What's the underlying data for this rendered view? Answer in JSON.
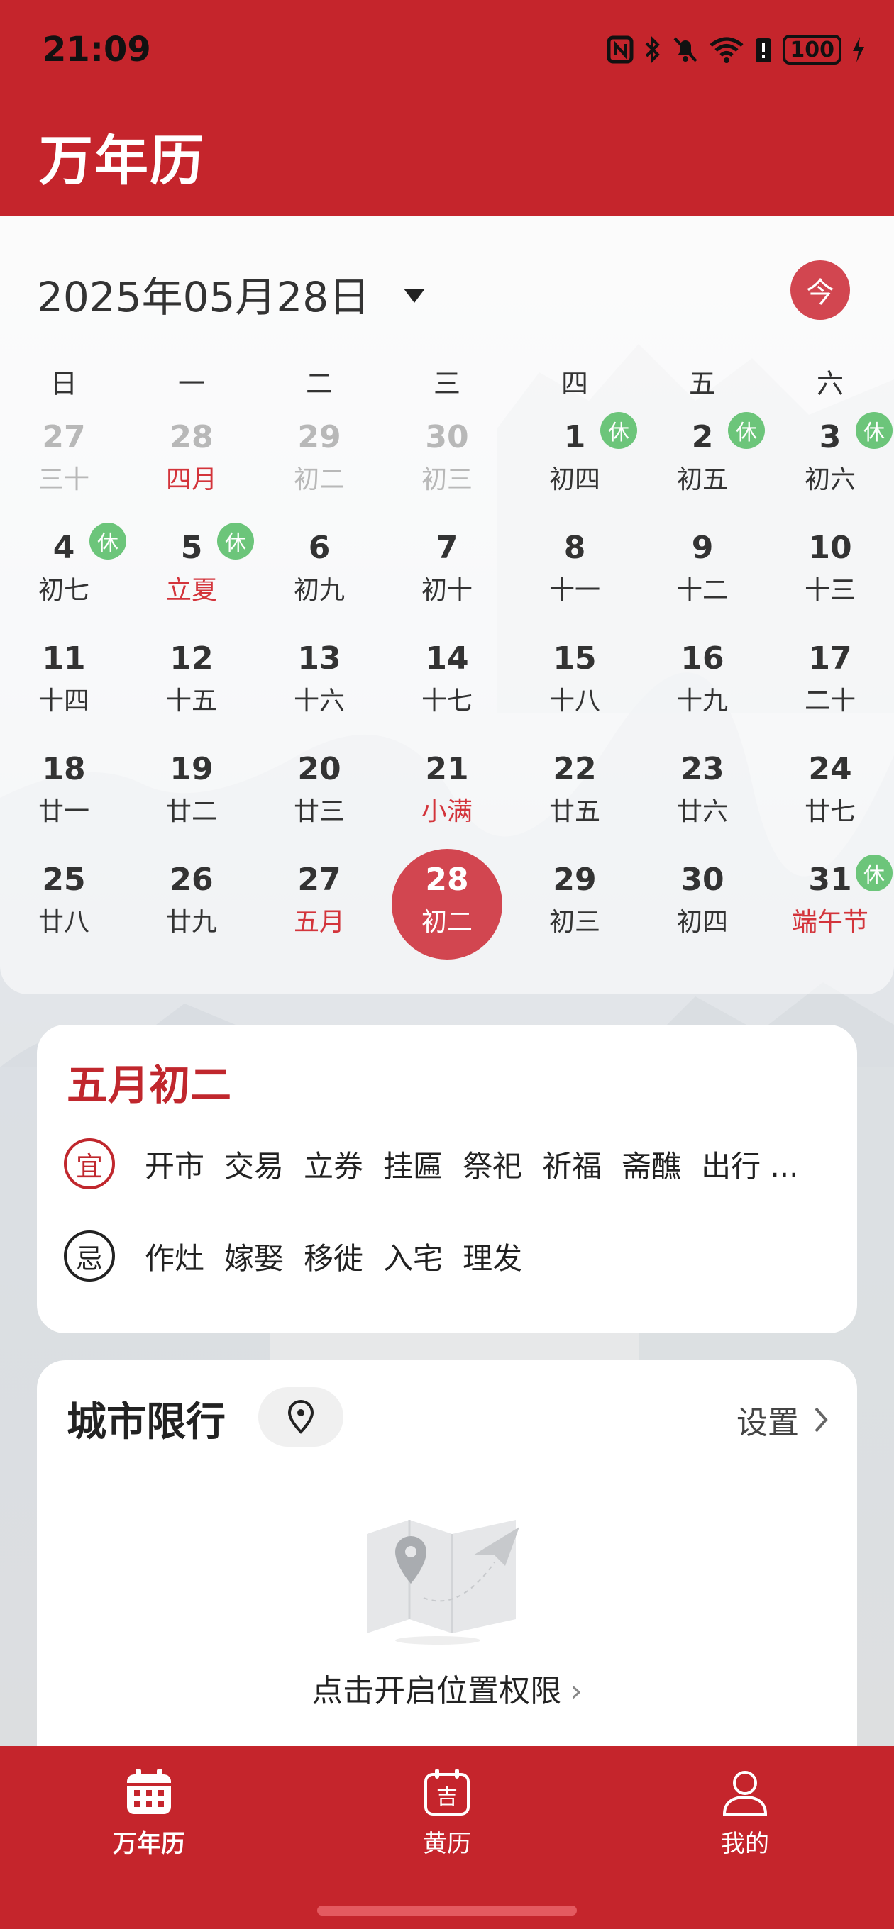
{
  "status_bar": {
    "time": "21:09",
    "battery": "100"
  },
  "app_title": "万年历",
  "calendar": {
    "header_date": "2025年05月28日",
    "today_label": "今",
    "weekdays": [
      "日",
      "一",
      "二",
      "三",
      "四",
      "五",
      "六"
    ],
    "days": [
      {
        "num": "27",
        "lunar": "三十",
        "dim": true
      },
      {
        "num": "28",
        "lunar": "四月",
        "dim": true,
        "red": true
      },
      {
        "num": "29",
        "lunar": "初二",
        "dim": true
      },
      {
        "num": "30",
        "lunar": "初三",
        "dim": true
      },
      {
        "num": "1",
        "lunar": "初四",
        "rest": "休"
      },
      {
        "num": "2",
        "lunar": "初五",
        "rest": "休"
      },
      {
        "num": "3",
        "lunar": "初六",
        "rest": "休"
      },
      {
        "num": "4",
        "lunar": "初七",
        "rest": "休"
      },
      {
        "num": "5",
        "lunar": "立夏",
        "rest": "休",
        "red": true
      },
      {
        "num": "6",
        "lunar": "初九"
      },
      {
        "num": "7",
        "lunar": "初十"
      },
      {
        "num": "8",
        "lunar": "十一"
      },
      {
        "num": "9",
        "lunar": "十二"
      },
      {
        "num": "10",
        "lunar": "十三"
      },
      {
        "num": "11",
        "lunar": "十四"
      },
      {
        "num": "12",
        "lunar": "十五"
      },
      {
        "num": "13",
        "lunar": "十六"
      },
      {
        "num": "14",
        "lunar": "十七"
      },
      {
        "num": "15",
        "lunar": "十八"
      },
      {
        "num": "16",
        "lunar": "十九"
      },
      {
        "num": "17",
        "lunar": "二十"
      },
      {
        "num": "18",
        "lunar": "廿一"
      },
      {
        "num": "19",
        "lunar": "廿二"
      },
      {
        "num": "20",
        "lunar": "廿三"
      },
      {
        "num": "21",
        "lunar": "小满",
        "red": true
      },
      {
        "num": "22",
        "lunar": "廿五"
      },
      {
        "num": "23",
        "lunar": "廿六"
      },
      {
        "num": "24",
        "lunar": "廿七"
      },
      {
        "num": "25",
        "lunar": "廿八"
      },
      {
        "num": "26",
        "lunar": "廿九"
      },
      {
        "num": "27",
        "lunar": "五月",
        "red": true
      },
      {
        "num": "28",
        "lunar": "初二",
        "selected": true
      },
      {
        "num": "29",
        "lunar": "初三"
      },
      {
        "num": "30",
        "lunar": "初四"
      },
      {
        "num": "31",
        "lunar": "端午节",
        "rest": "休",
        "red": true
      }
    ]
  },
  "almanac": {
    "title": "五月初二",
    "yi_label": "宜",
    "ji_label": "忌",
    "yi_items": [
      "开市",
      "交易",
      "立券",
      "挂匾",
      "祭祀",
      "祈福",
      "斋醮",
      "出行 ..."
    ],
    "ji_items": [
      "作灶",
      "嫁娶",
      "移徙",
      "入宅",
      "理发"
    ]
  },
  "city": {
    "title": "城市限行",
    "settings_label": "设置",
    "permission_link": "点击开启位置权限"
  },
  "bottom_nav": {
    "items": [
      {
        "label": "万年历",
        "icon": "calendar-icon",
        "active": true
      },
      {
        "label": "黄历",
        "icon": "almanac-icon"
      },
      {
        "label": "我的",
        "icon": "person-icon"
      }
    ]
  },
  "colors": {
    "brand_red": "#c5252c",
    "selected": "#d24650",
    "rest_badge": "#6cc57a"
  }
}
